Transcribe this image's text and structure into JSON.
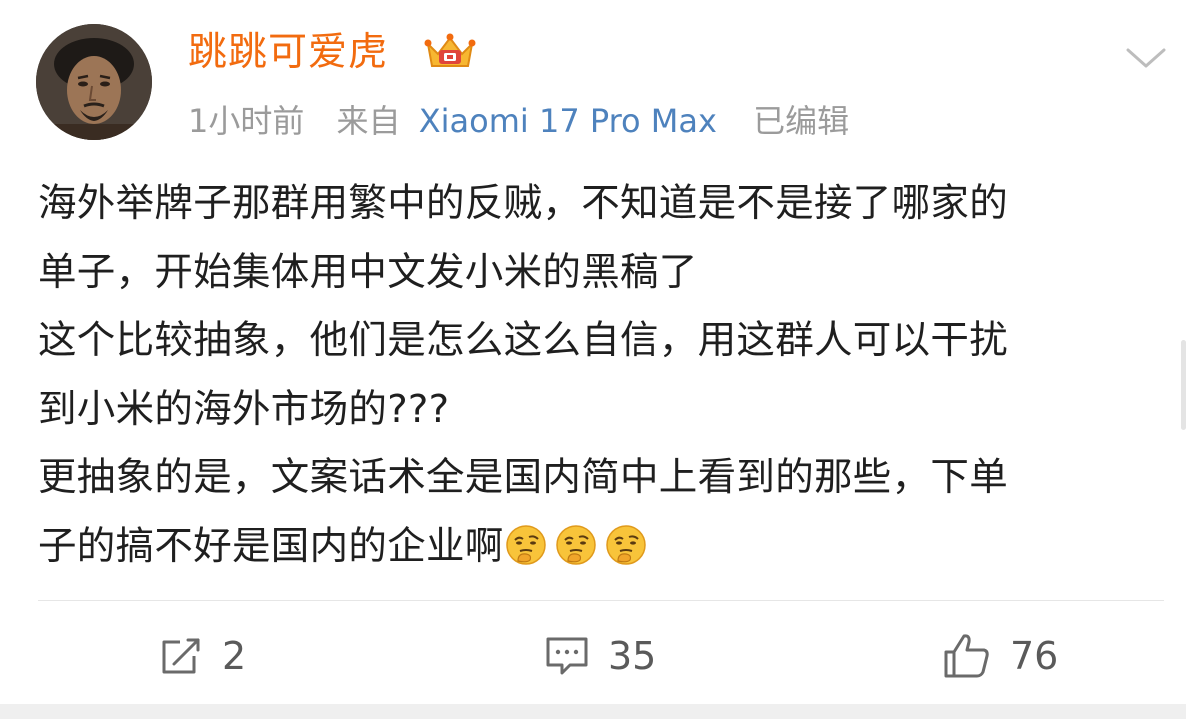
{
  "post": {
    "username": "跳跳可爱虎",
    "time": "1小时前",
    "source_prefix": "来自",
    "device": "Xiaomi 17 Pro Max",
    "edited": "已编辑",
    "content_lines": [
      "海外举牌子那群用繁中的反贼，不知道是不是接了哪家的",
      "单子，开始集体用中文发小米的黑稿了",
      "这个比较抽象，他们是怎么这么自信，用这群人可以干扰",
      "到小米的海外市场的???",
      "更抽象的是，文案话术全是国内简中上看到的那些，下单",
      "子的搞不好是国内的企业啊"
    ],
    "trailing_emoji": [
      "thinking-face-emoji",
      "thinking-face-emoji",
      "thinking-face-emoji"
    ]
  },
  "actions": {
    "repost_count": "2",
    "comment_count": "35",
    "like_count": "76"
  },
  "colors": {
    "username": "#f26b0f",
    "device_link": "#4e82bd",
    "meta_gray": "#9b9b9b",
    "text": "#1f1f1f"
  }
}
